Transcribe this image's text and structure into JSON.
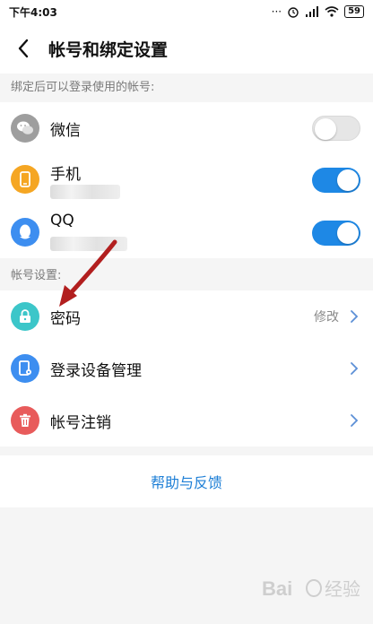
{
  "status_bar": {
    "time": "下午4:03",
    "battery": "59"
  },
  "header": {
    "title": "帐号和绑定设置"
  },
  "bound_section": {
    "label": "绑定后可以登录使用的帐号:",
    "items": [
      {
        "label": "微信",
        "icon": "wechat-icon",
        "icon_color": "#9e9e9e",
        "enabled": false
      },
      {
        "label": "手机",
        "icon": "phone-icon",
        "icon_color": "#f5a623",
        "enabled": true
      },
      {
        "label": "QQ",
        "icon": "qq-icon",
        "icon_color": "#3d8ef0",
        "enabled": true
      }
    ]
  },
  "account_section": {
    "label": "帐号设置:",
    "items": [
      {
        "label": "密码",
        "value": "修改",
        "icon": "lock-icon",
        "icon_color": "#3cc6c9"
      },
      {
        "label": "登录设备管理",
        "icon": "device-manage-icon",
        "icon_color": "#3d8ef0"
      },
      {
        "label": "帐号注销",
        "icon": "trash-icon",
        "icon_color": "#e85b5b"
      }
    ]
  },
  "help": {
    "label": "帮助与反馈"
  },
  "colors": {
    "accent": "#1e88e5",
    "link": "#1e7fd6",
    "annotation_arrow": "#b21f1f"
  }
}
